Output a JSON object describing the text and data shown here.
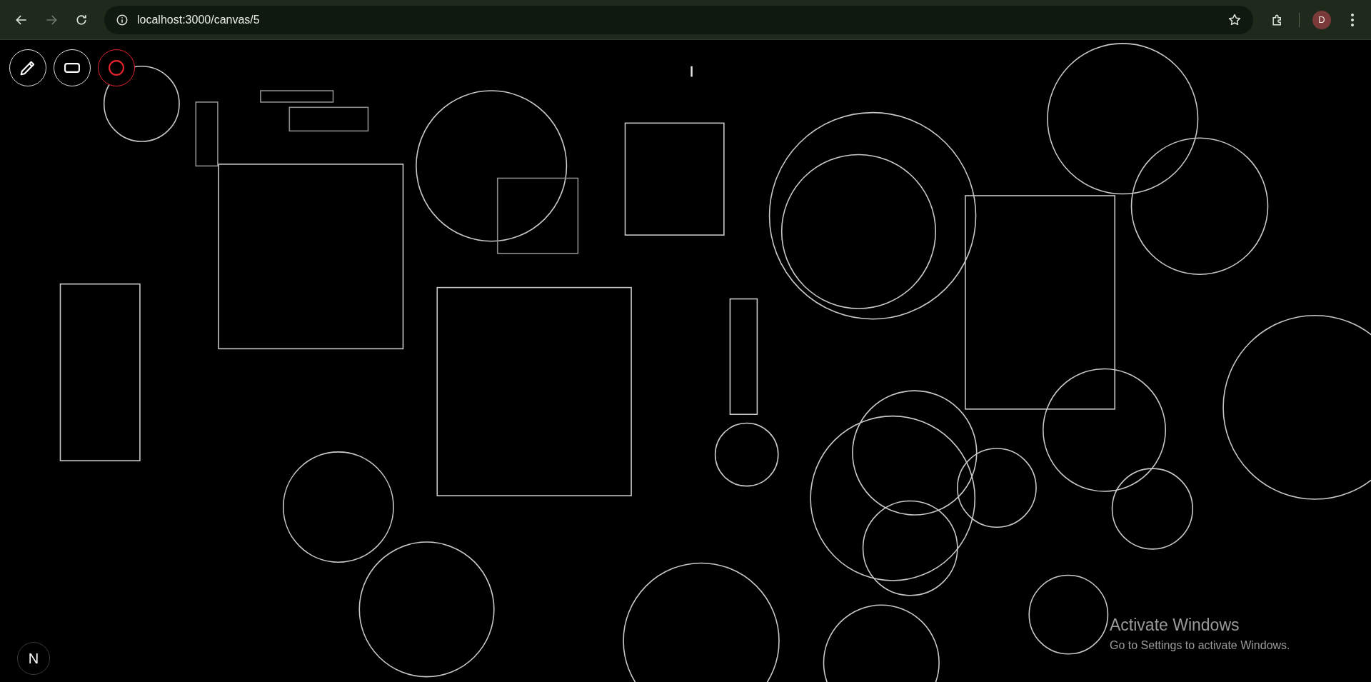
{
  "browser": {
    "nav": [
      {
        "kind": "back",
        "disabled": false
      },
      {
        "kind": "forward",
        "disabled": true
      },
      {
        "kind": "reload",
        "disabled": false
      }
    ],
    "url": "localhost:3000/canvas/5",
    "profile_initial": "D"
  },
  "tools": [
    {
      "kind": "pencil",
      "selected": false
    },
    {
      "kind": "rectangle",
      "selected": false
    },
    {
      "kind": "circle",
      "selected": true
    }
  ],
  "shapes": [
    {
      "kind": "circle"
    },
    {
      "kind": "circle"
    },
    {
      "kind": "circle"
    },
    {
      "kind": "circle"
    },
    {
      "kind": "circle"
    },
    {
      "kind": "circle"
    },
    {
      "kind": "circle"
    },
    {
      "kind": "circle"
    },
    {
      "kind": "circle"
    },
    {
      "kind": "circle"
    },
    {
      "kind": "circle"
    },
    {
      "kind": "circle"
    },
    {
      "kind": "circle"
    },
    {
      "kind": "circle"
    },
    {
      "kind": "circle"
    },
    {
      "kind": "circle"
    },
    {
      "kind": "circle"
    },
    {
      "kind": "circle"
    },
    {
      "kind": "circle"
    },
    {
      "kind": "rectangle"
    },
    {
      "kind": "rectangle"
    },
    {
      "kind": "rectangle"
    },
    {
      "kind": "rectangle"
    },
    {
      "kind": "rectangle"
    },
    {
      "kind": "rectangle"
    },
    {
      "kind": "rectangle"
    },
    {
      "kind": "rectangle"
    },
    {
      "kind": "rectangle"
    },
    {
      "kind": "rectangle"
    },
    {
      "kind": "line"
    }
  ],
  "dev_badge": "N",
  "os_notice": {
    "title": "Activate Windows",
    "text": "Go to Settings to activate Windows."
  }
}
